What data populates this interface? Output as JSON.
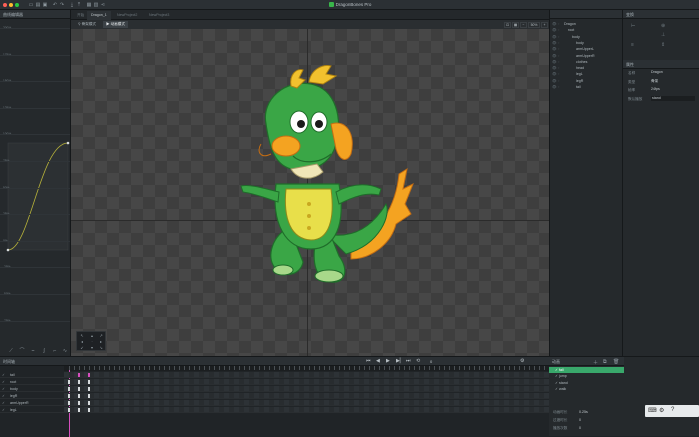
{
  "app": {
    "title": "DragonBones Pro"
  },
  "curve_panel": {
    "title": "曲线编辑器",
    "y_labels": [
      "200%",
      "175%",
      "150%",
      "125%",
      "100%",
      "75%",
      "50%",
      "25%",
      "0%",
      "-25%",
      "-50%",
      "-75%"
    ]
  },
  "tabs": [
    "开始",
    "Dragon_1",
    "NewProject2",
    "NewProject3"
  ],
  "viewport": {
    "tool1": "骨架模式",
    "tool2": "动画模式",
    "zoom": "50%"
  },
  "scene_tree": {
    "rows": [
      {
        "name": "Dragon",
        "indent": 0
      },
      {
        "name": "root",
        "indent": 1
      },
      {
        "name": "body",
        "indent": 2
      },
      {
        "name": "body",
        "indent": 3
      },
      {
        "name": "armUpperL",
        "indent": 3
      },
      {
        "name": "armUpperR",
        "indent": 3
      },
      {
        "name": "clothes",
        "indent": 3
      },
      {
        "name": "head",
        "indent": 3
      },
      {
        "name": "legL",
        "indent": 3
      },
      {
        "name": "legR",
        "indent": 3
      },
      {
        "name": "tail",
        "indent": 3
      }
    ]
  },
  "transform": {
    "title": "变换",
    "props_title": "属性",
    "rows": [
      {
        "label": "名称",
        "value": "Dragon"
      },
      {
        "label": "类型",
        "value": "骨架"
      },
      {
        "label": "帧率",
        "value": "24fps"
      },
      {
        "label": "默认播放",
        "value": "stand"
      }
    ]
  },
  "timeline": {
    "title": "时间轴",
    "layers": [
      "tail",
      "root",
      "body",
      "legR",
      "armUpperR",
      "legL"
    ],
    "frame_label": "0"
  },
  "animation_panel": {
    "title": "动画",
    "items": [
      "fall",
      "jump",
      "stand",
      "walk"
    ],
    "selected": 0,
    "footer": [
      {
        "label": "动画时长",
        "value": "0.25s"
      },
      {
        "label": "过渡时长",
        "value": "0"
      },
      {
        "label": "播放次数",
        "value": "0"
      }
    ]
  },
  "colors": {
    "accent": "#39a86b",
    "keyframe_pink": "#d64fbe"
  }
}
